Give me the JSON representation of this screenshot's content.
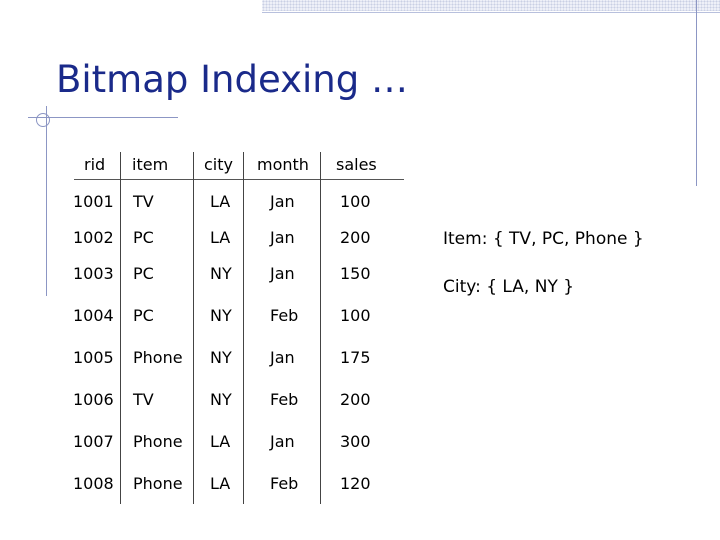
{
  "slide": {
    "title": "Bitmap Indexing …"
  },
  "table": {
    "headers": [
      "rid",
      "item",
      "city",
      "month",
      "sales"
    ],
    "rows": [
      [
        "1001",
        "TV",
        "LA",
        "Jan",
        "100"
      ],
      [
        "1002",
        "PC",
        "LA",
        "Jan",
        "200"
      ],
      [
        "1003",
        "PC",
        "NY",
        "Jan",
        "150"
      ],
      [
        "1004",
        "PC",
        "NY",
        "Feb",
        "100"
      ],
      [
        "1005",
        "Phone",
        "NY",
        "Jan",
        "175"
      ],
      [
        "1006",
        "TV",
        "NY",
        "Feb",
        "200"
      ],
      [
        "1007",
        "Phone",
        "LA",
        "Jan",
        "300"
      ],
      [
        "1008",
        "Phone",
        "LA",
        "Feb",
        "120"
      ]
    ]
  },
  "notes": {
    "item_domain": "Item: { TV, PC, Phone }",
    "city_domain": "City: { LA, NY }"
  }
}
